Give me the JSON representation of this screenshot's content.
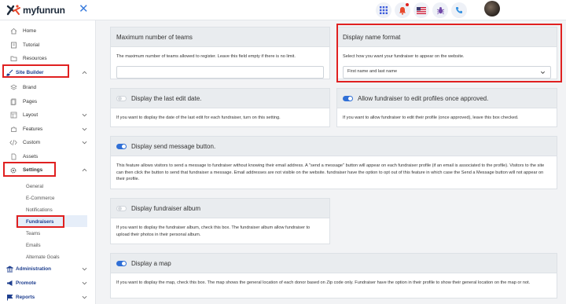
{
  "app": {
    "logo_text": "myfunrun"
  },
  "sidebar": {
    "items": [
      {
        "label": "Home"
      },
      {
        "label": "Tutorial"
      },
      {
        "label": "Resources"
      },
      {
        "label": "Site Builder"
      },
      {
        "label": "Brand"
      },
      {
        "label": "Pages"
      },
      {
        "label": "Layout"
      },
      {
        "label": "Features"
      },
      {
        "label": "Custom"
      },
      {
        "label": "Assets"
      },
      {
        "label": "Settings"
      }
    ],
    "settings_sub": [
      "General",
      "E-Commerce",
      "Notifications",
      "Fundraisers",
      "Teams",
      "Emails",
      "Alternate Goals"
    ],
    "sections": [
      "Administration",
      "Promote",
      "Reports"
    ]
  },
  "cards": {
    "max_teams": {
      "title": "Maximum number of teams",
      "desc": "The maximum number of teams allowed to register. Leave this field empty if there is no limit.",
      "value": ""
    },
    "display_name": {
      "title": "Display name format",
      "desc": "Select how you want your fundraiser to appear on the website.",
      "selected": "First name and last name"
    },
    "last_edit": {
      "title": "Display the last edit date.",
      "desc": "If you want to display the date of the last edit for each fundraiser, turn on this setting.",
      "enabled": false
    },
    "edit_profiles": {
      "title": "Allow fundraiser to edit profiles once approved.",
      "desc": "If you want to allow fundraiser to edit their profile (once approved), leave this box checked.",
      "enabled": true
    },
    "send_message": {
      "title": "Display send message button.",
      "desc": "This feature allows visitors to send a message to fundraiser without knowing their email address. A \"send a message\" button will appear on each fundraiser profile (if an email is associated to the profile). Visitors to the site can then click the button to send that fundraiser a message. Email addresses are not visible on the website. fundraiser have the option to opt out of this feature in which case the Send a Message button will not appear on their profile.",
      "enabled": true
    },
    "album": {
      "title": "Display fundraiser album",
      "desc": "If you want to display the fundraiser album, check this box. The fundraiser album allow fundraiser to upload their photos in their personal album.",
      "enabled": false
    },
    "map": {
      "title": "Display a map",
      "desc": "If you want to display the map, check this box. The map shows the general location of each donor based on Zip code only. Fundraiser have the option in their profile to show their general location on the map or not.",
      "enabled": true
    }
  },
  "colors": {
    "accent": "#2f6fd6",
    "highlight": "#e02020",
    "section": "#1f3f8f"
  }
}
